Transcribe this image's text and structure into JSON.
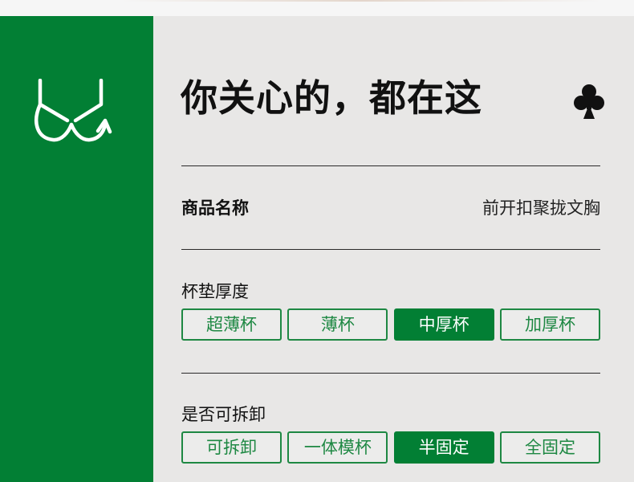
{
  "header": {
    "title": "你关心的，都在这"
  },
  "icons": {
    "sidebar_icon": "bra-icon",
    "corner_icon": "club-suit-icon"
  },
  "colors": {
    "brand_green": "#027f34",
    "panel_bg": "#e8e7e6"
  },
  "product": {
    "label": "商品名称",
    "value": "前开扣聚拢文胸"
  },
  "cup_thickness": {
    "label": "杯垫厚度",
    "selected": "中厚杯",
    "options": [
      "超薄杯",
      "薄杯",
      "中厚杯",
      "加厚杯"
    ]
  },
  "detachable": {
    "label": "是否可拆卸",
    "selected": "半固定",
    "options": [
      "可拆卸",
      "一体模杯",
      "半固定",
      "全固定"
    ]
  }
}
